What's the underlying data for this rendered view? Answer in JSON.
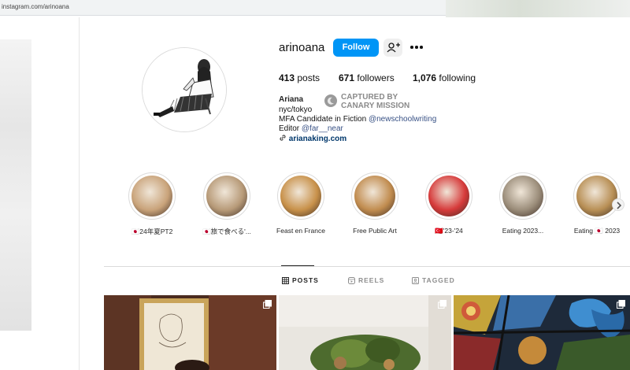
{
  "browser": {
    "url": "instagram.com/arinoana"
  },
  "profile": {
    "username": "arinoana",
    "follow_label": "Follow",
    "stats": {
      "posts_count": "413",
      "posts_label": "posts",
      "followers_count": "671",
      "followers_label": "followers",
      "following_count": "1,076",
      "following_label": "following"
    },
    "bio": {
      "name": "Ariana",
      "location": "nyc/tokyo",
      "line1_prefix": "MFA Candidate in Fiction ",
      "line1_mention": "@newschoolwriting",
      "line2_prefix": "Editor ",
      "line2_mention": "@far__near",
      "link": "arianaking.com"
    },
    "watermark": {
      "line1": "CAPTURED BY",
      "line2": "CANARY MISSION"
    }
  },
  "highlights": [
    {
      "label": "🇯🇵24年夏PT2",
      "color": "#c9a37a"
    },
    {
      "label": "🇯🇵旅で食べる'...",
      "color": "#b79a78"
    },
    {
      "label": "Feast en France",
      "color": "#c8914a"
    },
    {
      "label": "Free Public Art",
      "color": "#c18c4f"
    },
    {
      "label": "🇹🇷'23-'24",
      "color": "#d63a3a"
    },
    {
      "label": "Eating 2023...",
      "color": "#9b8d7a"
    },
    {
      "label": "Eating 🇯🇵 2023",
      "color": "#b88f55"
    }
  ],
  "tabs": [
    {
      "label": "POSTS",
      "icon": "grid-icon",
      "active": true
    },
    {
      "label": "REELS",
      "icon": "reels-icon",
      "active": false
    },
    {
      "label": "TAGGED",
      "icon": "tagged-icon",
      "active": false
    }
  ],
  "posts": [
    {
      "icon": "multi-post-icon"
    },
    {
      "icon": "multi-post-icon"
    },
    {
      "icon": "multi-post-icon"
    }
  ]
}
